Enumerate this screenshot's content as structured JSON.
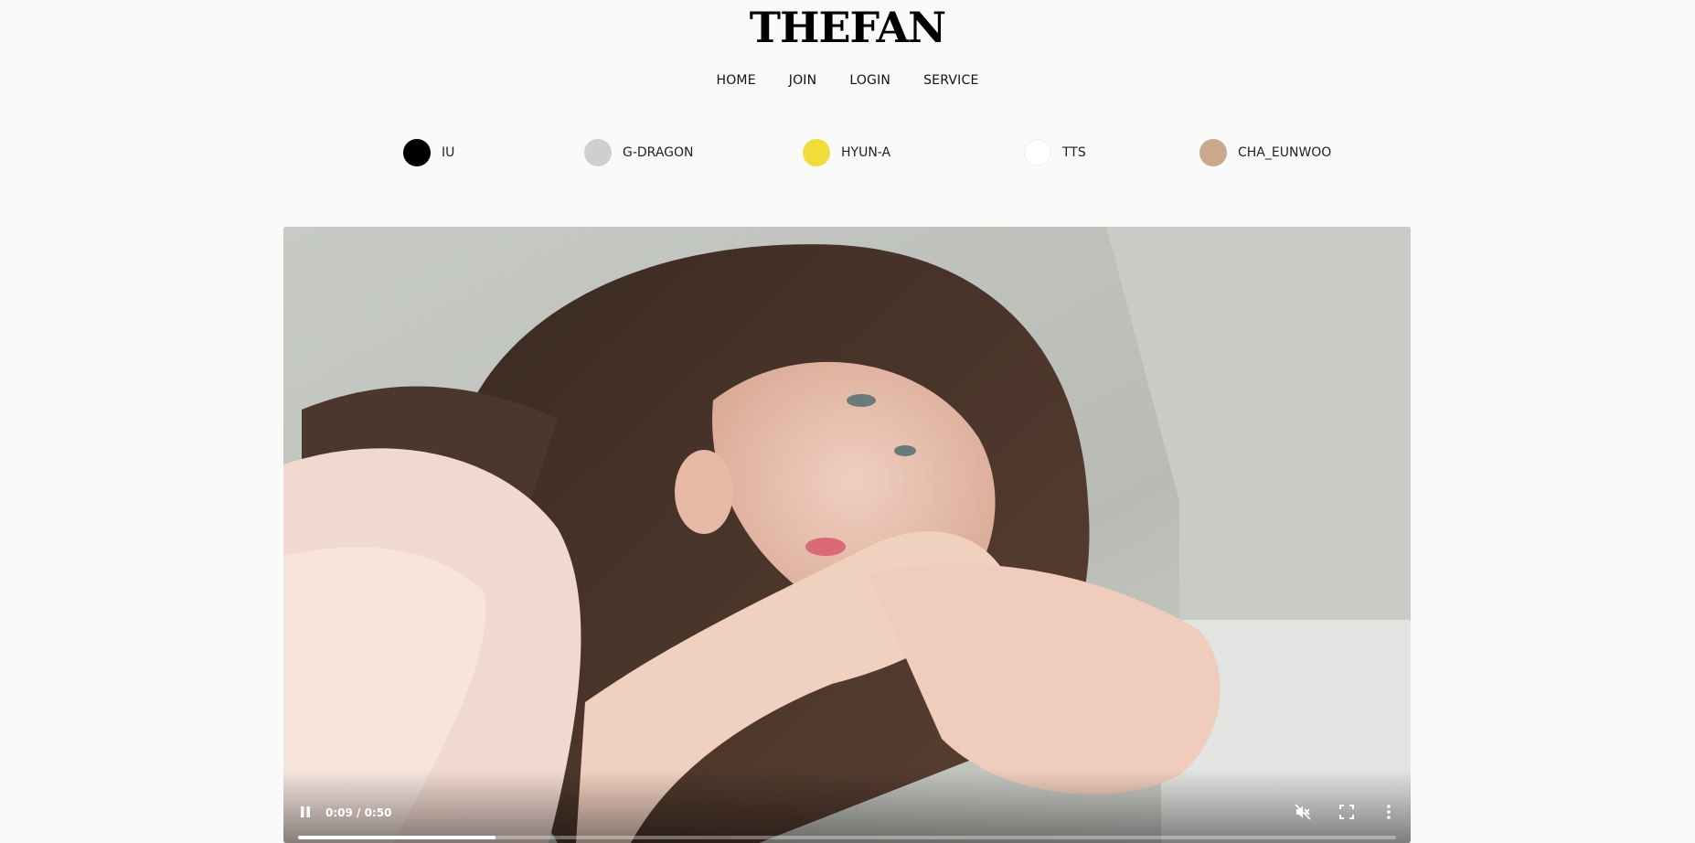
{
  "brand": {
    "logo_text": "THEFAN"
  },
  "nav": {
    "items": [
      {
        "label": "HOME"
      },
      {
        "label": "JOIN"
      },
      {
        "label": "LOGIN"
      },
      {
        "label": "SERVICE"
      }
    ]
  },
  "artists": [
    {
      "label": "IU",
      "color": "#000000"
    },
    {
      "label": "G-DRAGON",
      "color": "#cfcfcf"
    },
    {
      "label": "HYUN-A",
      "color": "#f2dc3a"
    },
    {
      "label": "TTS",
      "color": "#ffffff"
    },
    {
      "label": "CHA_EUNWOO",
      "color": "#c9a98a"
    }
  ],
  "video": {
    "time_display": "0:09 / 0:50",
    "progress_fraction": 0.18,
    "playing": true,
    "muted": true
  }
}
